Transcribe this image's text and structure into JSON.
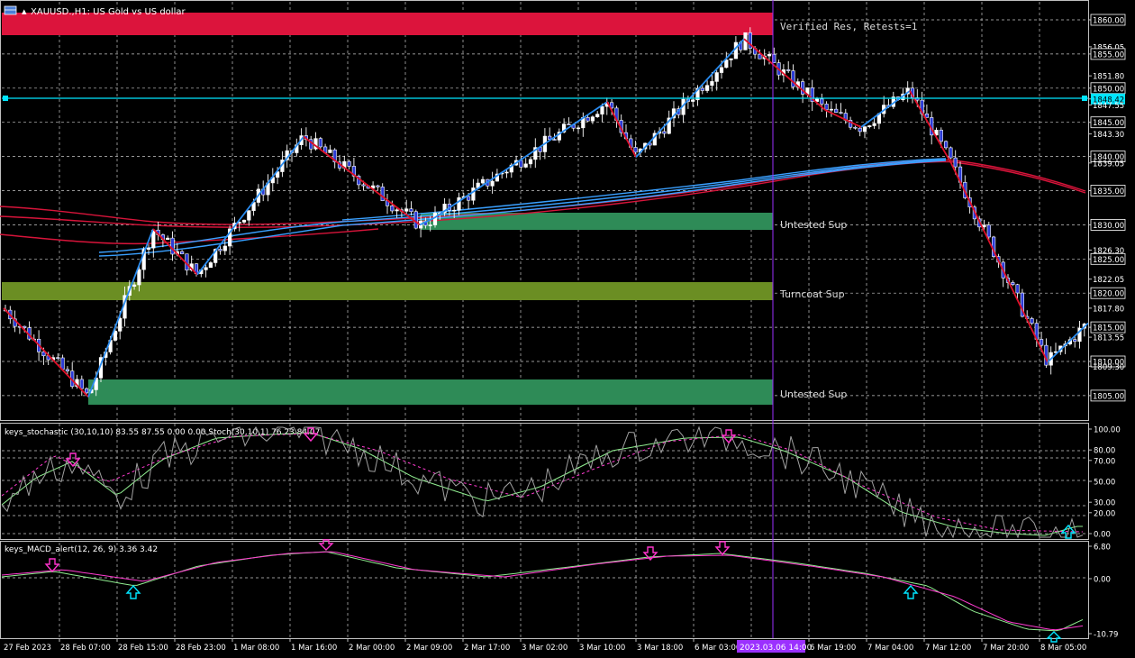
{
  "window": {
    "title": "XAUUSD.,H1: US Gold vs US dollar",
    "colors": {
      "background": "#000000",
      "grid": "#c0c0c0",
      "axis_text": "#ffffff",
      "bull": "#ffffff",
      "bear": "#2b3bd6",
      "zig_up": "#2a8cf0",
      "zig_down": "#e0102a"
    }
  },
  "price_scale": {
    "labels": [
      "1860.00",
      "1856.05",
      "1855.00",
      "1851.80",
      "1850.00",
      "1848.42",
      "1847.55",
      "1845.00",
      "1843.30",
      "1840.00",
      "1839.05",
      "1835.00",
      "1830.00",
      "1826.30",
      "1825.00",
      "1822.05",
      "1820.00",
      "1817.80",
      "1815.00",
      "1813.55",
      "1810.00",
      "1809.30",
      "1805.00"
    ],
    "boxed": [
      "1860.00",
      "1855.00",
      "1850.00",
      "1848.42",
      "1845.00",
      "1840.00",
      "1835.00",
      "1830.00",
      "1825.00",
      "1820.00",
      "1815.00",
      "1810.00",
      "1805.00"
    ],
    "current_price": "1848.42"
  },
  "zones": [
    {
      "label": "Verified Res, Retests=1",
      "color": "#dc143c"
    },
    {
      "label": "Untested Sup",
      "color": "#2e8b57"
    },
    {
      "label": "Turncoat Sup",
      "color": "#6b8e23"
    },
    {
      "label": "Untested Sup",
      "color": "#2e8b57"
    }
  ],
  "stochastic": {
    "title": "keys_stochastic (30,10,10) 83.55 87.55 0.00 0.00 Stoch(30,10,1) 76.23 84.07",
    "scale": [
      "100.00",
      "80.00",
      "70.00",
      "50.00",
      "30.00",
      "20.00",
      "0.00"
    ]
  },
  "macd": {
    "title": "keys_MACD_alert(12, 26, 9) 3.36 3.42",
    "scale": [
      "6.80",
      "0.00",
      "-10.79"
    ]
  },
  "time_axis": {
    "labels": [
      "27 Feb 2023",
      "28 Feb 07:00",
      "28 Feb 15:00",
      "28 Feb 23:00",
      "1 Mar 08:00",
      "1 Mar 16:00",
      "2 Mar 00:00",
      "2 Mar 09:00",
      "2 Mar 17:00",
      "3 Mar 02:00",
      "3 Mar 10:00",
      "3 Mar 18:00",
      "6 Mar 03:00",
      "6 Mar 19:00",
      "7 Mar 04:00",
      "7 Mar 12:00",
      "7 Mar 20:00",
      "8 Mar 05:00"
    ],
    "crosshair_label": "2023.03.06 14:00"
  },
  "chart_data": {
    "type": "candlestick",
    "symbol": "XAUUSD.",
    "timeframe": "H1",
    "ylim": [
      1803.5,
      1861.5
    ],
    "zigzag": [
      1817.8,
      1804.8,
      1829.4,
      1822.7,
      1842.9,
      1830.0,
      1830.0,
      1848.0,
      1839.9,
      1857.2,
      1846.8,
      1844.3,
      1849.6,
      1839.0,
      1809.9,
      1815.6
    ],
    "zones": [
      {
        "label": "Verified Res, Retests=1",
        "from": 1857.3,
        "to": 1860.5
      },
      {
        "label": "Untested Sup",
        "from": 1829.2,
        "to": 1831.3
      },
      {
        "label": "Turncoat Sup",
        "from": 1819.0,
        "to": 1820.6
      },
      {
        "label": "Untested Sup",
        "from": 1804.6,
        "to": 1808.1
      }
    ],
    "horizontal_line": 1848.42
  }
}
